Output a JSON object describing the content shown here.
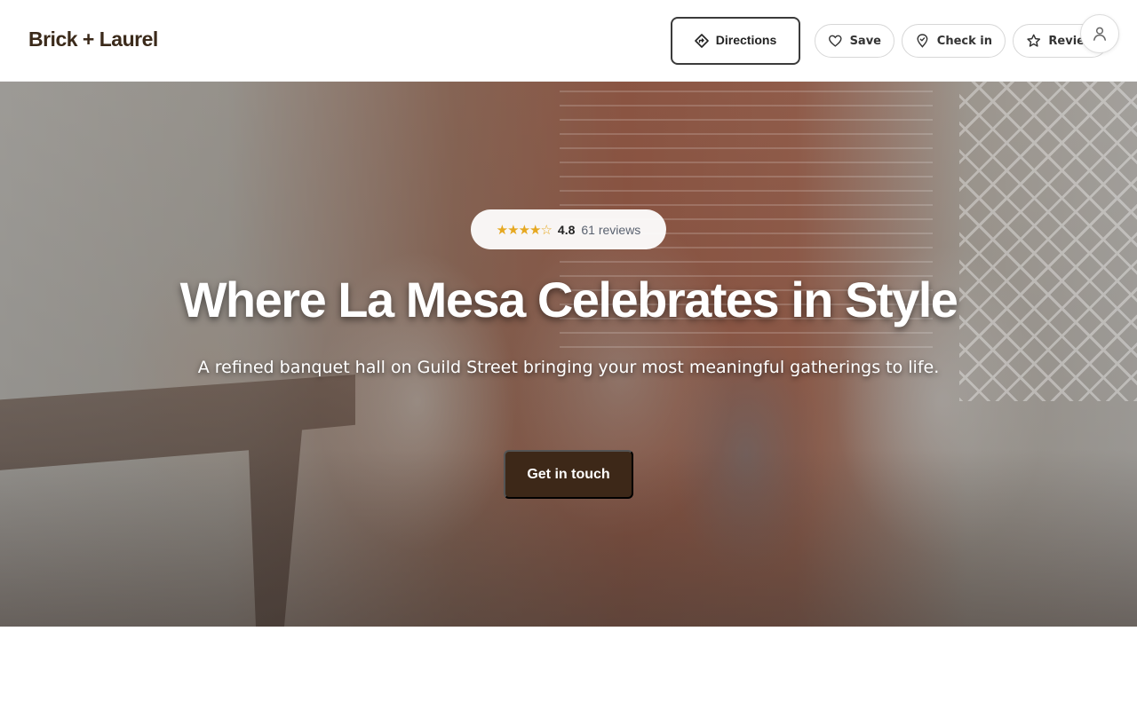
{
  "header": {
    "brand": "Brick + Laurel",
    "directions_label": "Directions",
    "actions": [
      {
        "label": "Save",
        "icon": "heart-icon"
      },
      {
        "label": "Check in",
        "icon": "map-pin-icon"
      },
      {
        "label": "Review",
        "icon": "star-icon"
      }
    ],
    "profile_icon": "user-icon"
  },
  "hero": {
    "rating": {
      "stars_display": "★★★★☆",
      "value": "4.8",
      "count_label": "61 reviews"
    },
    "title": "Where La Mesa Celebrates in Style",
    "subtitle": "A refined banquet hall on Guild Street bringing your most meaningful gatherings to life.",
    "cta_label": "Get in touch"
  },
  "colors": {
    "brand_text": "#3b2a1a",
    "cta_background": "#3d2818",
    "star": "#e6a820"
  }
}
